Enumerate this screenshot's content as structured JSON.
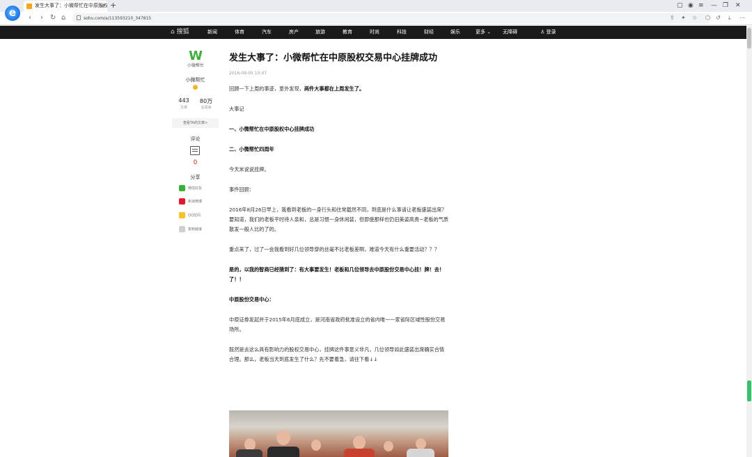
{
  "browser": {
    "tab_title": "发生大事了：小微帮忙在中原股权交",
    "tab_close": "×",
    "new_tab": "+",
    "url": "sohu.com/a/113593210_347815",
    "logo_glyph": "e",
    "nav_back": "‹",
    "nav_forward": "›",
    "nav_reload": "↻",
    "nav_home": "⌂"
  },
  "site_nav": {
    "logo": "⌂ 搜狐",
    "items": [
      "新闻",
      "体育",
      "汽车",
      "房产",
      "旅游",
      "教育",
      "时尚",
      "科技",
      "财经",
      "娱乐",
      "更多 ⌄",
      "无障碍"
    ],
    "login": "♙ 登录"
  },
  "author": {
    "logo_glyph": "W",
    "logo_text": "小微帮忙",
    "name": "小微帮忙",
    "articles_count": "443",
    "articles_label": "文章",
    "reads_count": "80万",
    "reads_label": "总阅读",
    "all_articles_link": "查看TA的文章>",
    "comment_label": "评论",
    "comment_count": "0",
    "share_label": "分享",
    "share_items": [
      "微信好友",
      "新浪微博",
      "QQ空间",
      "复制链接"
    ]
  },
  "article": {
    "title": "发生大事了：小微帮忙在中原股权交易中心挂牌成功",
    "date": "2016-09-05 10:47",
    "p1_normal": "回顾一下上周的事迹，意外发现，",
    "p1_bold": "两件大事都在上周发生了。",
    "p2": "大事记",
    "p3": "一、小微帮忙在中原股权中心挂牌成功",
    "p4": "二、小微帮忙四周年",
    "p5": "今天米说说挂牌。",
    "p6": "事件回顾：",
    "p7": "2016年8月26日早上，我看到老板的一身行头和往常截然不同，到底是什么事请让老板盛装出席？要知道，我们的老板平时待人亲和，总是习惯一身休闲装，但即使那样也仍旧美姿高贵~老板的气质散发一般人比的了的。",
    "p8": "重点来了，过了一会我看到好几位领导穿的丝毫不比老板差啊，难道今天有什么重要活动？？？",
    "p9": "是的，以我的智商已经猜到了：有大事要发生！老板和几位领导去中原股份交易中心挂！牌！去！了！！",
    "p10": "中原股份交易中心：",
    "p11": "中原证券发起并于2015年6月底成立，是河南省政府批准设立的省内唯一一家省际区域性股份交易场所。",
    "p12": "既然是去这么具有影响力的股权交易中心，挂牌这件事意义非凡，几位领导如此盛装出席确实合情合理。那么，老板当天到底发生了什么？先不要着急，请往下看↓↓"
  },
  "colors": {
    "nav_bg": "#1a1a1a",
    "accent_red": "#d9261c",
    "author_green": "#3cae3a"
  }
}
